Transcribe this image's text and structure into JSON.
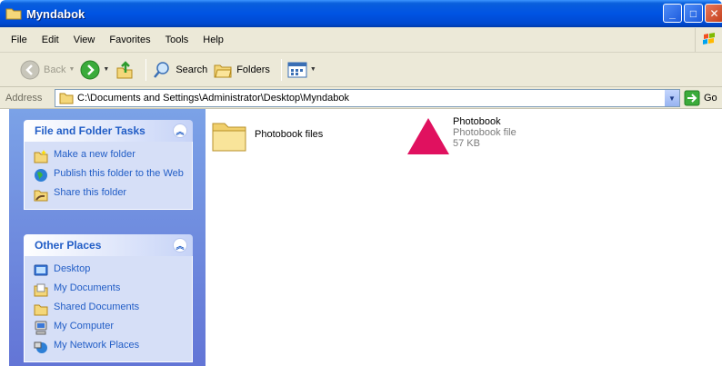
{
  "window": {
    "title": "Myndabok"
  },
  "menu": {
    "items": [
      "File",
      "Edit",
      "View",
      "Favorites",
      "Tools",
      "Help"
    ]
  },
  "toolbar": {
    "back_label": "Back",
    "search_label": "Search",
    "folders_label": "Folders"
  },
  "address": {
    "label": "Address",
    "path": "C:\\Documents and Settings\\Administrator\\Desktop\\Myndabok",
    "go_label": "Go"
  },
  "tasks": {
    "title": "File and Folder Tasks",
    "items": [
      "Make a new folder",
      "Publish this folder to the Web",
      "Share this folder"
    ]
  },
  "places": {
    "title": "Other Places",
    "items": [
      "Desktop",
      "My Documents",
      "Shared Documents",
      "My Computer",
      "My Network Places"
    ]
  },
  "files": [
    {
      "name": "Photobook files",
      "type": "folder"
    },
    {
      "name": "Photobook",
      "type_label": "Photobook file",
      "size": "57 KB",
      "icon_color": "#e0115f"
    }
  ],
  "colors": {
    "title_bar": "#0054e3",
    "task_link": "#215dc6",
    "panel": "#6f8ee0"
  }
}
